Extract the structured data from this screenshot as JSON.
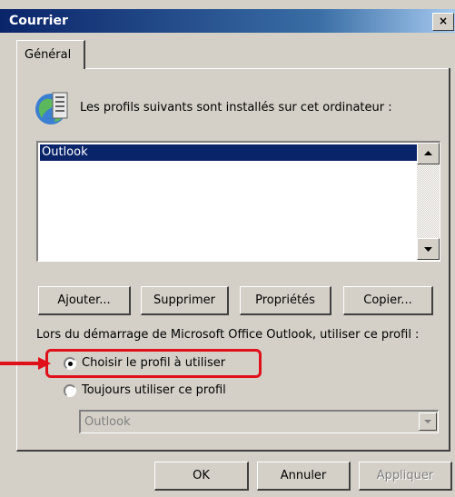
{
  "window": {
    "title": "Courrier",
    "close_label": "×"
  },
  "tabs": [
    {
      "label": "Général"
    }
  ],
  "profiles": {
    "description": "Les profils suivants sont installés sur cet ordinateur :",
    "items": [
      "Outlook"
    ],
    "selected": "Outlook"
  },
  "buttons": {
    "add": "Ajouter...",
    "delete": "Supprimer",
    "properties": "Propriétés",
    "copy": "Copier...",
    "ok": "OK",
    "cancel": "Annuler",
    "apply": "Appliquer"
  },
  "startup": {
    "label": "Lors du démarrage de Microsoft Office Outlook, utiliser ce profil :",
    "options": [
      {
        "label": "Choisir le profil à utiliser",
        "selected": true
      },
      {
        "label": "Toujours utiliser ce profil",
        "selected": false
      }
    ],
    "profile_select_value": "Outlook"
  },
  "colors": {
    "highlight": "#e0101a",
    "title_bar": "#0a246a",
    "selection": "#0a246a"
  }
}
